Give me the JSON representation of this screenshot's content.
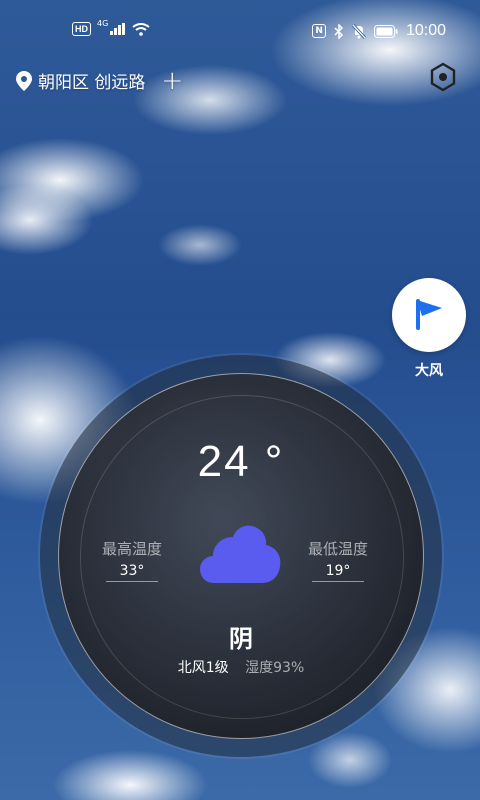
{
  "status_bar": {
    "hd": "HD",
    "network": "4G",
    "nfc": "N",
    "time": "10:00",
    "icons": [
      "signal-icon",
      "wifi-icon",
      "nfc-icon",
      "bluetooth-icon",
      "mute-icon",
      "battery-icon"
    ]
  },
  "header": {
    "location": "朝阳区 创远路",
    "add_label": "+",
    "icons": [
      "location-pin-icon",
      "settings-hexagon-icon"
    ]
  },
  "alert": {
    "label": "大风",
    "icon": "flag-icon",
    "color": "#1e6ff0"
  },
  "weather": {
    "current_temp": "24 °",
    "max_label": "最高温度",
    "max_value": "33°",
    "min_label": "最低温度",
    "min_value": "19°",
    "condition": "阴",
    "wind": "北风1级",
    "humidity": "湿度93%",
    "cloud_icon": "cloud-icon",
    "cloud_color": "#5a5cf0"
  }
}
